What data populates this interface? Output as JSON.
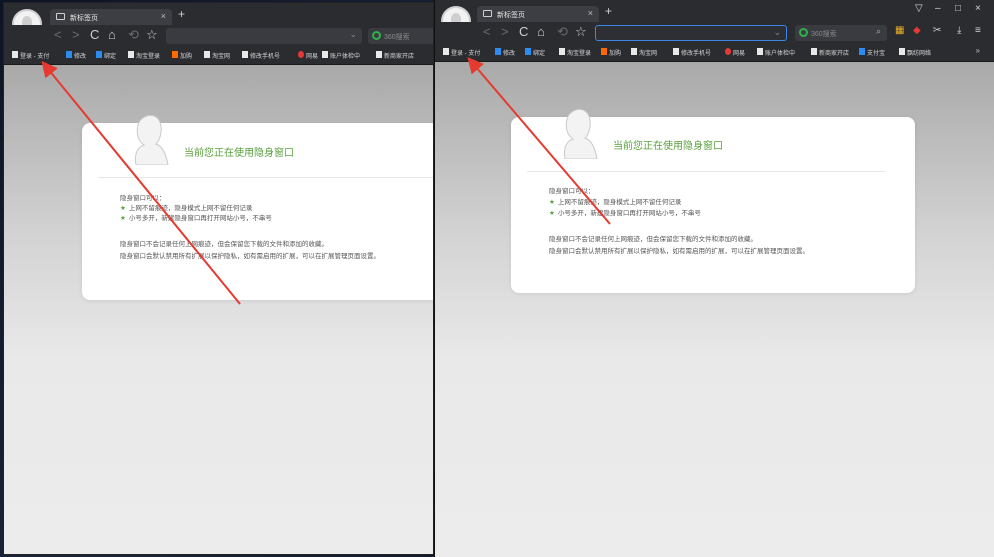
{
  "desktop": {
    "side_labels": [
      "",
      "",
      "",
      ""
    ]
  },
  "windows": [
    {
      "id": "left",
      "tab": {
        "title": "新标签页",
        "close": "×"
      },
      "newtab": "+",
      "nav": {
        "back": "<",
        "forward": ">",
        "reload": "C",
        "home": "⌂",
        "undo": "⟲",
        "star": "☆"
      },
      "search": {
        "placeholder": "360搜索"
      },
      "bookmarks": [
        "登录 - 支付",
        "修改",
        "绑定",
        "淘宝登录",
        "加购",
        "淘宝网",
        "修改手机号",
        "网易",
        "账户体检中",
        "新商家开店"
      ],
      "card": {
        "title": "当前您正在使用隐身窗口",
        "intro": "隐身窗口可以：",
        "bullet1": "上网不留痕迹，隐身模式上网不留任何记录",
        "bullet2": "小号多开，新建隐身窗口再打开网站小号，不串号",
        "note1": "隐身窗口不会记录任何上网痕迹，但会保留您下载的文件和添加的收藏。",
        "note2": "隐身窗口会默认禁用所有扩展以保护隐私，如有需启用的扩展，可以在扩展管理页面设置。"
      }
    },
    {
      "id": "right",
      "tab": {
        "title": "新标签页",
        "close": "×"
      },
      "newtab": "+",
      "nav": {
        "back": "<",
        "forward": ">",
        "reload": "C",
        "home": "⌂",
        "undo": "⟲",
        "star": "☆"
      },
      "search": {
        "placeholder": "360搜索"
      },
      "window_controls": {
        "skin": "▽",
        "minimize": "–",
        "maximize": "□",
        "close": "×"
      },
      "toolbar_icons": {
        "apps": "▦",
        "game": "◆",
        "cut": "✂",
        "download": "⤓",
        "menu": "≡"
      },
      "bookmarks": [
        "登录 - 支付",
        "修改",
        "绑定",
        "淘宝登录",
        "加购",
        "淘宝网",
        "修改手机号",
        "网易",
        "账户体检中",
        "新商家开店",
        "支付宝",
        "飘纺网络"
      ],
      "bookmarks_more": "»",
      "card": {
        "title": "当前您正在使用隐身窗口",
        "intro": "隐身窗口可以：",
        "bullet1": "上网不留痕迹，隐身模式上网不留任何记录",
        "bullet2": "小号多开，新建隐身窗口再打开网站小号，不串号",
        "note1": "隐身窗口不会记录任何上网痕迹，但会保留您下载的文件和添加的收藏。",
        "note2": "隐身窗口会默认禁用所有扩展以保护隐私，如有需启用的扩展，可以在扩展管理页面设置。"
      }
    }
  ],
  "colors": {
    "accent_green": "#5aa03d",
    "annotation_red": "#e53a2f",
    "chrome_dark": "#2b2c30",
    "focus_blue": "#3c86e6"
  }
}
